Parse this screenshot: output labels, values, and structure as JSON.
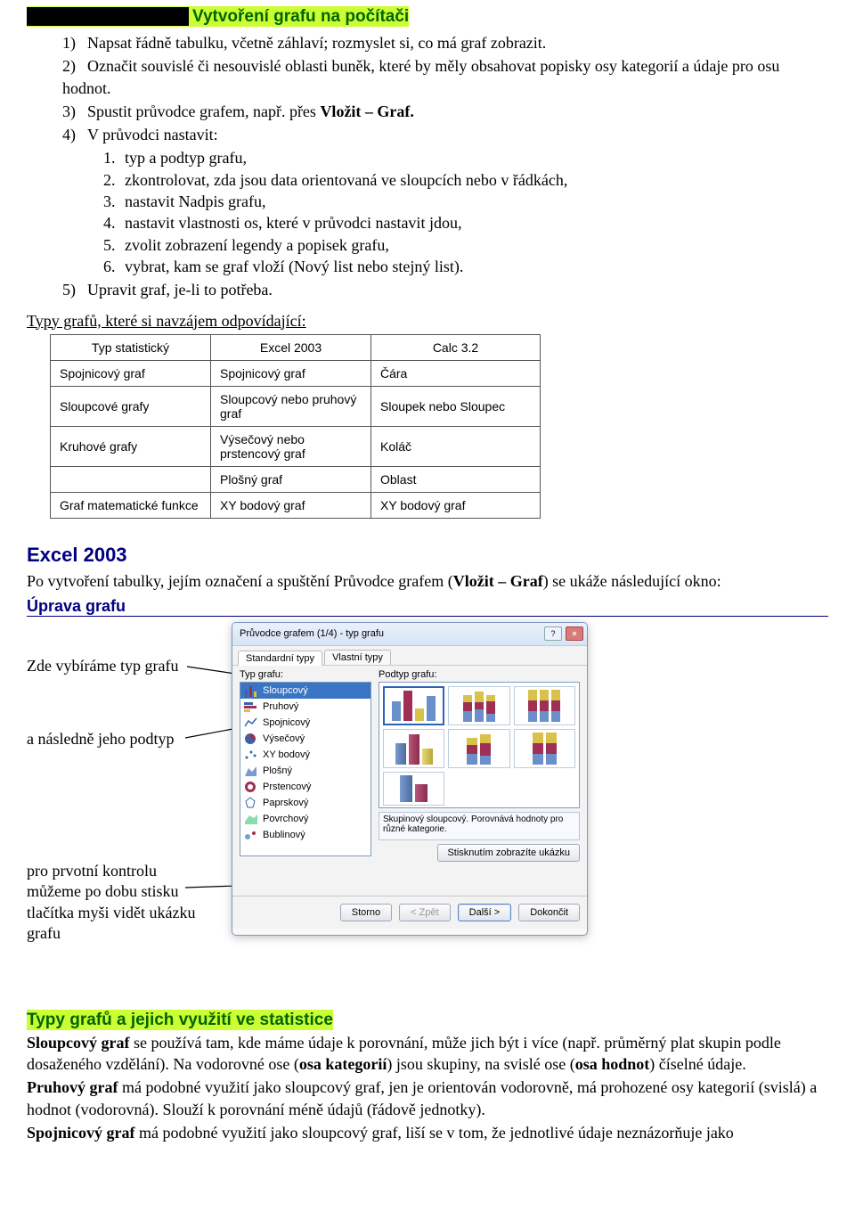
{
  "title": "Vytvoření grafu na počítači",
  "steps": [
    "Napsat řádně tabulku, včetně záhlaví; rozmyslet si, co má graf zobrazit.",
    "Označit souvislé či nesouvislé oblasti buněk, které by měly obsahovat popisky osy kategorií a údaje pro osu hodnot.",
    "Spustit průvodce grafem, např. přes ",
    "V průvodci nastavit:",
    "Upravit graf, je-li to potřeba."
  ],
  "step3_bold": "Vložit – Graf.",
  "substeps": [
    "typ a podtyp grafu,",
    "zkontrolovat, zda jsou data orientovaná ve sloupcích nebo v řádkách,",
    "nastavit Nadpis grafu,",
    "nastavit vlastnosti os, které v průvodci nastavit jdou,",
    "zvolit zobrazení legendy a popisek grafu,",
    "vybrat, kam se graf vloží (Nový list nebo stejný list)."
  ],
  "types_note": "Typy grafů, které si navzájem odpovídající:",
  "table": {
    "headers": [
      "Typ statistický",
      "Excel 2003",
      "Calc 3.2"
    ],
    "rows": [
      [
        "Spojnicový graf",
        "Spojnicový graf",
        "Čára"
      ],
      [
        "Sloupcové grafy",
        "Sloupcový nebo pruhový graf",
        "Sloupek nebo Sloupec"
      ],
      [
        "Kruhové grafy",
        "Výsečový nebo prstencový graf",
        "Koláč"
      ],
      [
        "",
        "Plošný graf",
        "Oblast"
      ],
      [
        "Graf matematické funkce",
        "XY bodový graf",
        "XY bodový graf"
      ]
    ]
  },
  "excel_heading": "Excel 2003",
  "excel_intro_pre": "Po vytvoření tabulky, jejím označení a spuštění Průvodce grafem (",
  "excel_intro_bold": "Vložit – Graf",
  "excel_intro_post": ") se ukáže následující okno:",
  "uprava_heading": "Úprava grafu",
  "captions": {
    "c1": "Zde vybíráme typ grafu",
    "c2": "a následně jeho podtyp",
    "c3": "pro prvotní kontrolu můžeme po dobu stisku tlačítka myši vidět ukázku grafu"
  },
  "wizard": {
    "title": "Průvodce grafem (1/4) - typ grafu",
    "tabs": [
      "Standardní typy",
      "Vlastní typy"
    ],
    "typ_label": "Typ grafu:",
    "podtyp_label": "Podtyp grafu:",
    "typ_list": [
      "Sloupcový",
      "Pruhový",
      "Spojnicový",
      "Výsečový",
      "XY bodový",
      "Plošný",
      "Prstencový",
      "Paprskový",
      "Povrchový",
      "Bublinový"
    ],
    "desc": "Skupinový sloupcový. Porovnává hodnoty pro různé kategorie.",
    "sample_btn": "Stisknutím zobrazíte ukázku",
    "buttons": {
      "storno": "Storno",
      "back": "< Zpět",
      "next": "Další >",
      "finish": "Dokončit"
    }
  },
  "types_stat_title": "Typy grafů a jejich využití ve statistice",
  "para1_bold1": "Sloupcový graf",
  "para1_text1": " se používá tam, kde máme údaje k porovnání, může jich být i více (např. průměrný plat skupin podle dosaženého vzdělání). Na vodorovné ose (",
  "para1_bold2": "osa kategorií",
  "para1_text2": ") jsou skupiny, na svislé ose (",
  "para1_bold3": "osa hodnot",
  "para1_text3": ") číselné údaje.",
  "para2_bold": "Pruhový graf",
  "para2_text": " má podobné využití jako sloupcový graf, jen je orientován vodorovně, má prohozené osy kategorií (svislá) a hodnot (vodorovná). Slouží k porovnání méně údajů (řádově jednotky).",
  "para3_bold": "Spojnicový graf",
  "para3_text": " má podobné využití jako sloupcový graf, liší se v tom, že jednotlivé údaje neznázorňuje jako"
}
